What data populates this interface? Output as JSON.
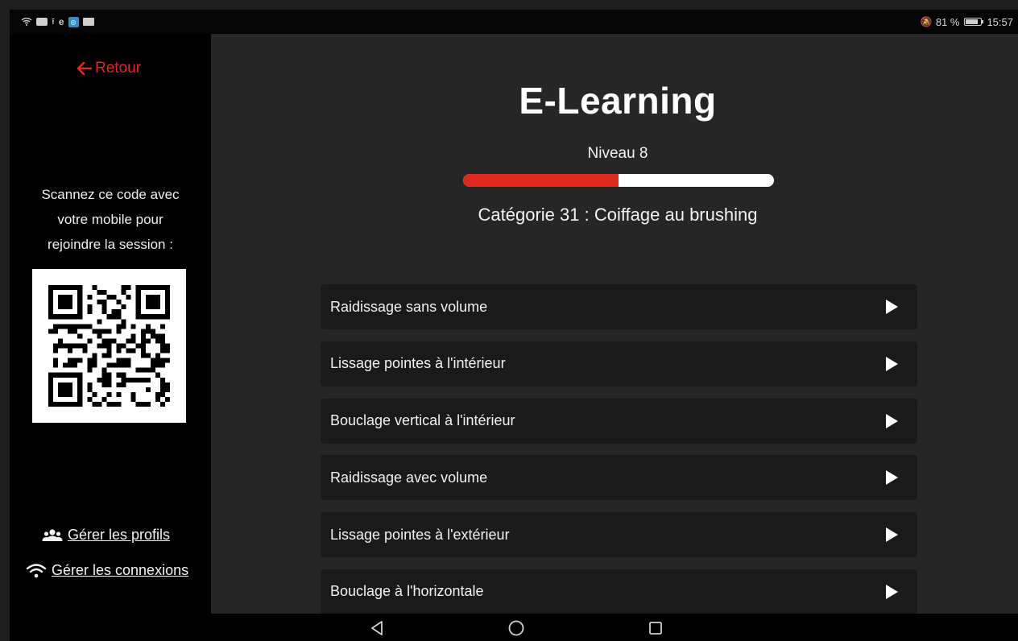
{
  "status_bar": {
    "time": "15:57",
    "battery_percent": "81 %",
    "battery_level": 0.81,
    "left_icons": [
      "wifi-icon",
      "youtube-icon",
      "upload-icon",
      "e-icon",
      "app-icon",
      "mail-icon"
    ],
    "right_icons": [
      "notifications-off-icon",
      "battery-icon"
    ]
  },
  "sidebar": {
    "back_label": "Retour",
    "scan_line1": "Scannez ce code avec",
    "scan_line2": "votre mobile pour",
    "scan_line3": "rejoindre la session :",
    "manage_profiles": "Gérer les profils",
    "manage_connections": "Gérer les connexions"
  },
  "main": {
    "title": "E-Learning",
    "level": "Niveau 8",
    "level_progress": 0.5,
    "category": "Catégorie 31 : Coiffage au brushing",
    "lessons": [
      "Raidissage sans volume",
      "Lissage pointes à l'intérieur",
      "Bouclage vertical à l'intérieur",
      "Raidissage avec volume",
      "Lissage pointes à l'extérieur",
      "Bouclage à l'horizontale"
    ]
  },
  "colors": {
    "accent": "#e0281d",
    "background": "#262626",
    "sidebar": "#000000",
    "card": "#1a1a1a"
  },
  "nav_bar": {
    "icons": [
      "back-triangle-icon",
      "home-circle-icon",
      "recent-square-icon"
    ]
  }
}
